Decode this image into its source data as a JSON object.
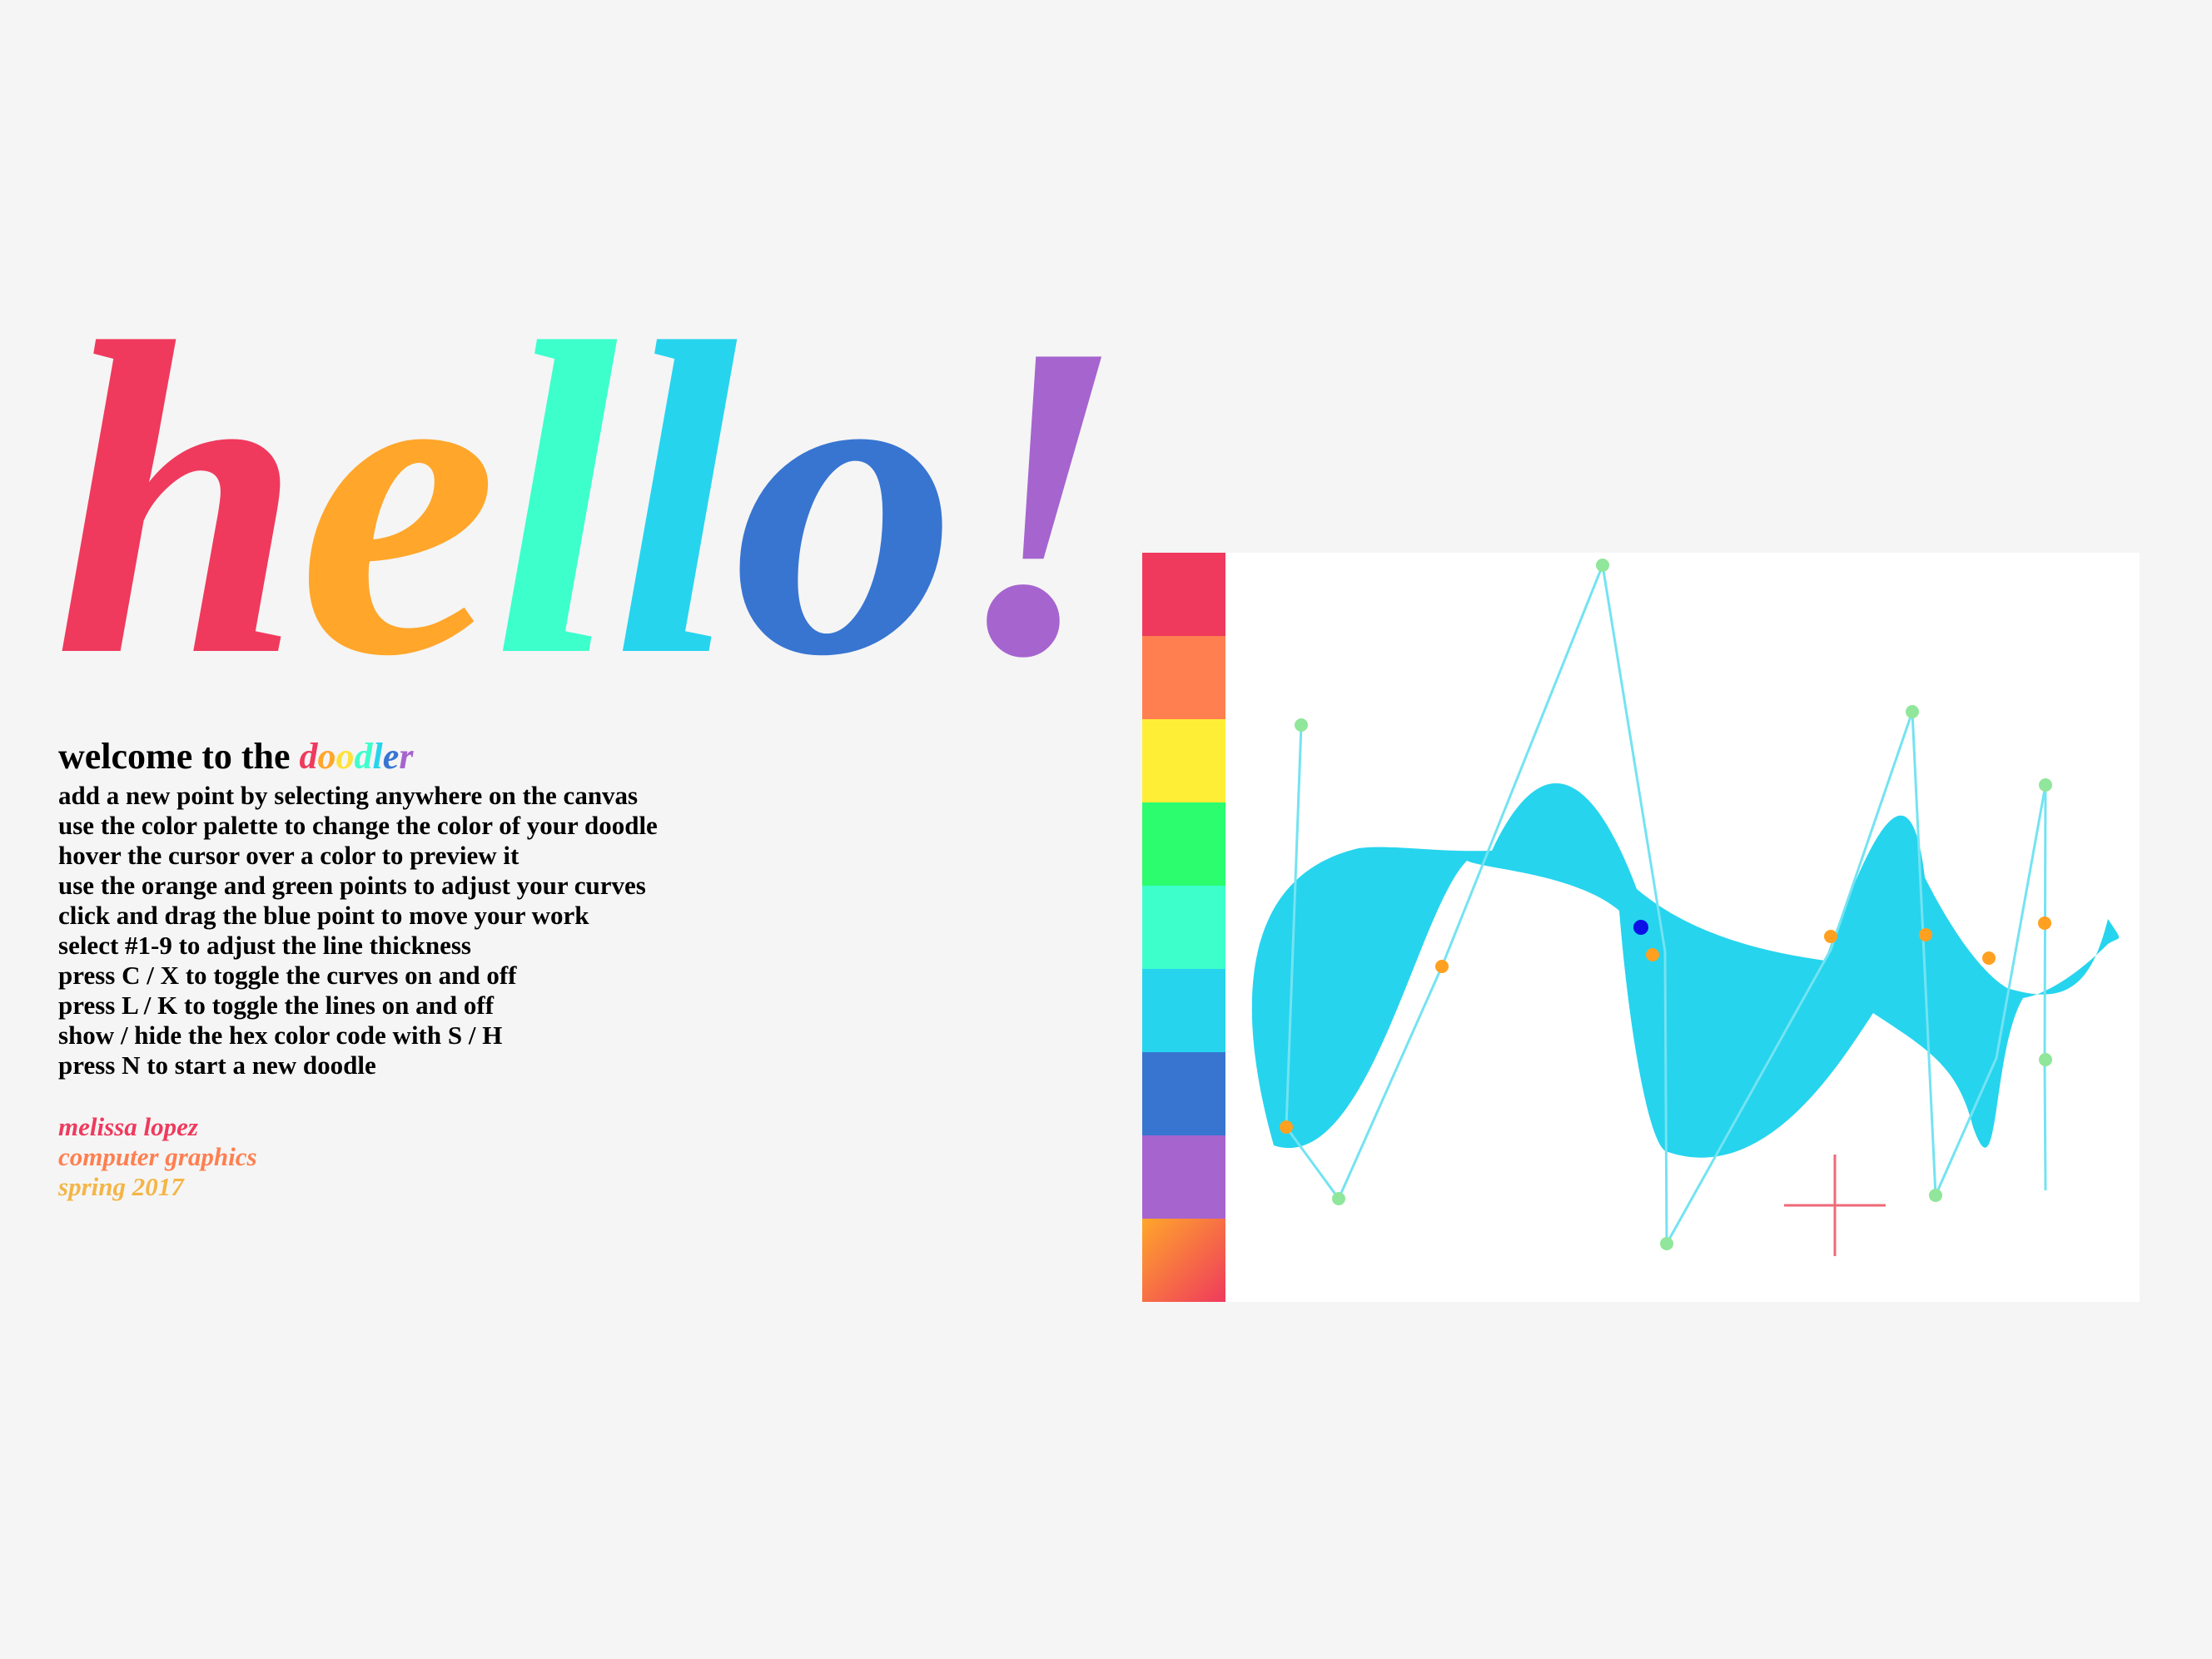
{
  "title": {
    "letters": [
      {
        "char": "h",
        "color": "#ef3a5d"
      },
      {
        "char": "e",
        "color": "#ffa62b"
      },
      {
        "char": "l",
        "color": "#3dffcc"
      },
      {
        "char": "l",
        "color": "#26d4ee"
      },
      {
        "char": "o",
        "color": "#3875d1"
      },
      {
        "char": "!",
        "color": "#a664cf"
      }
    ]
  },
  "welcome": {
    "prefix": "welcome to the ",
    "word_letters": [
      {
        "char": "d",
        "color": "#ef3a5d"
      },
      {
        "char": "o",
        "color": "#ffa62b"
      },
      {
        "char": "o",
        "color": "#ffe23a"
      },
      {
        "char": "d",
        "color": "#3dffcc"
      },
      {
        "char": "l",
        "color": "#26d4ee"
      },
      {
        "char": "e",
        "color": "#3875d1"
      },
      {
        "char": "r",
        "color": "#a664cf"
      }
    ]
  },
  "instructions": [
    "add a new point by selecting anywhere on the canvas",
    "use the color palette to change the color of your doodle",
    "hover the cursor over a color to preview it",
    "use the orange and green points to adjust your curves",
    "click and drag the blue point to move your work",
    "select #1-9 to adjust the line thickness",
    "press C / X to toggle the curves on and off",
    "press L / K to toggle the lines on and off",
    "show / hide the hex color code with S / H",
    "press N to start a new doodle"
  ],
  "credits": [
    {
      "text": "melissa lopez",
      "color": "#ef3a5d"
    },
    {
      "text": "computer graphics",
      "color": "#ff7f50"
    },
    {
      "text": "spring 2017",
      "color": "#f4b547"
    }
  ],
  "palette": {
    "swatches": [
      {
        "name": "red",
        "color": "#ef3a5d"
      },
      {
        "name": "coral",
        "color": "#ff7f50"
      },
      {
        "name": "yellow",
        "color": "#ffee36"
      },
      {
        "name": "green",
        "color": "#2bfd6f"
      },
      {
        "name": "aqua",
        "color": "#3dffcc"
      },
      {
        "name": "cyan",
        "color": "#26d4ee"
      },
      {
        "name": "blue",
        "color": "#3875d1"
      },
      {
        "name": "purple",
        "color": "#a664cf"
      },
      {
        "name": "gradient",
        "color": "linear-gradient(to bottom right, #ffa62b, #ef3a5d)"
      }
    ],
    "selected_index": 5
  },
  "doodle": {
    "fill_color": "#26d4ee",
    "line_color": "#73e3f2",
    "control_point_color": "#90e69a",
    "tangent_point_color": "#ffa020",
    "anchor_point_color": "#0a10e6",
    "cursor_icon": "crosshair-cursor-icon",
    "cursor_color": "#ef6a78"
  }
}
